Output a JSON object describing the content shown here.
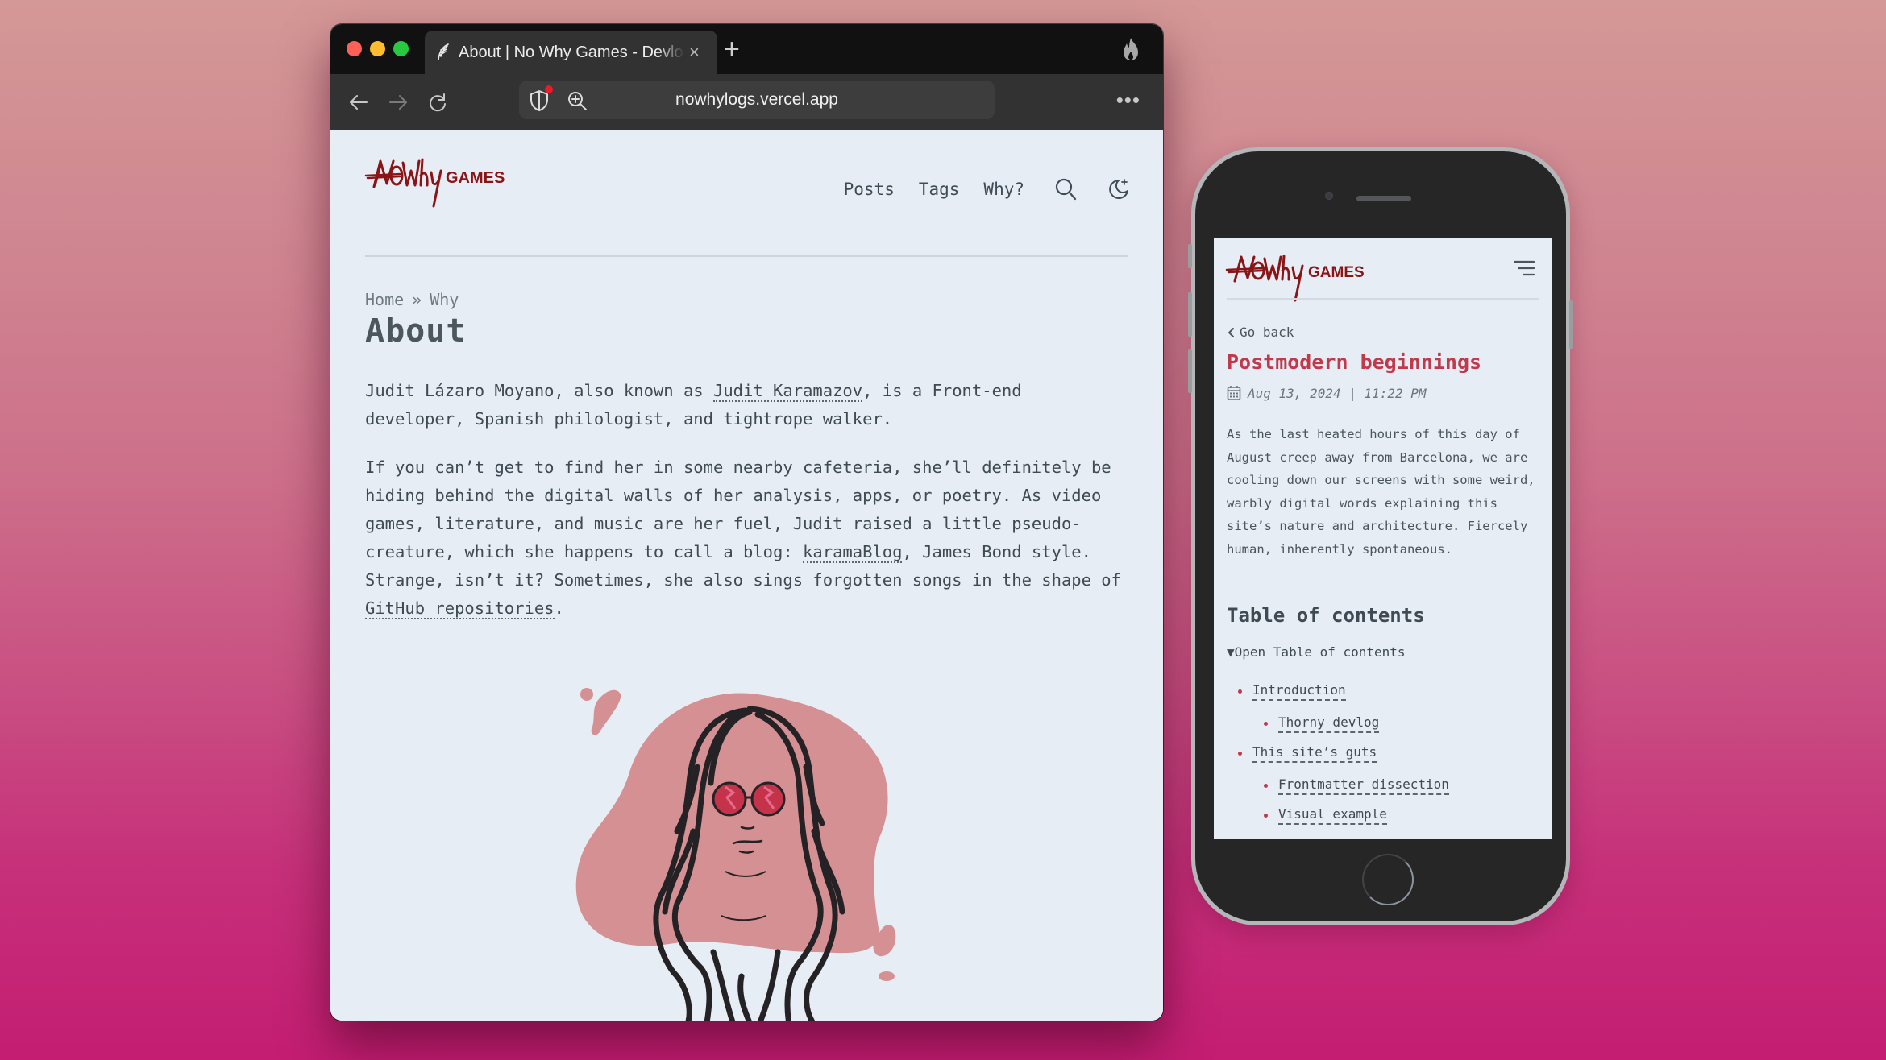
{
  "browser": {
    "tab": {
      "title": "About | No Why Games - Devlog",
      "favicon": "feather-icon",
      "close_icon": "close-icon"
    },
    "new_tab_label": "+",
    "extension_icon": "flame-icon",
    "toolbar": {
      "back_icon": "arrow-left-icon",
      "forward_icon": "arrow-right-icon",
      "reload_icon": "reload-icon",
      "shield_icon": "shield-icon",
      "zoom_icon": "zoom-in-icon",
      "url": "nowhylogs.vercel.app",
      "menu_label": "•••"
    }
  },
  "site": {
    "logo": {
      "main": "NOWhy",
      "sub": "GAMES",
      "color": "#8b1416"
    },
    "nav": {
      "items": [
        {
          "label": "Posts"
        },
        {
          "label": "Tags"
        },
        {
          "label": "Why?"
        }
      ],
      "search_icon": "search-icon",
      "theme_icon": "moon-icon"
    },
    "breadcrumb": {
      "home": "Home",
      "separator": "»",
      "current": "Why"
    },
    "title": "About",
    "paragraphs": {
      "p1": {
        "before": "Judit Lázaro Moyano, also known as ",
        "link": "Judit Karamazov",
        "after": ", is a Front-end developer, Spanish philologist, and tightrope walker."
      },
      "p2": {
        "before": "If you can’t get to find her in some nearby cafeteria, she’ll definitely be hiding behind the digital walls of her analysis, apps, or poetry. As video games, literature, and music are her fuel, Judit raised a little pseudo-creature, which she happens to call a blog: ",
        "link1": "karamaBlog",
        "middle": ", James Bond style. Strange, isn’t it? Sometimes, she also sings forgotten songs in the shape of ",
        "link2": "GitHub repositories",
        "after": "."
      }
    },
    "avatar_alt": "Illustrated portrait of Judit with long dark hair and red glasses",
    "accent": "#c03a4c",
    "blob_color": "#d49093"
  },
  "mobile": {
    "menu_icon": "hamburger-menu-icon",
    "back_label": "Go back",
    "post_title": "Postmodern beginnings",
    "date": "Aug 13, 2024 | 11:22 PM",
    "calendar_icon": "calendar-icon",
    "intro": "As the last heated hours of this day of August creep away from Barcelona, we are cooling down our screens with some weird, warbly digital words explaining this site’s nature and architecture. Fiercely human, inherently spontaneous.",
    "toc": {
      "heading": "Table of contents",
      "toggle": "▼Open Table of contents",
      "items": [
        {
          "label": "Introduction",
          "level": 1
        },
        {
          "label": "Thorny devlog",
          "level": 2
        },
        {
          "label": "This site’s guts",
          "level": 1
        },
        {
          "label": "Frontmatter dissection",
          "level": 2
        },
        {
          "label": "Visual example",
          "level": 2
        }
      ]
    }
  }
}
